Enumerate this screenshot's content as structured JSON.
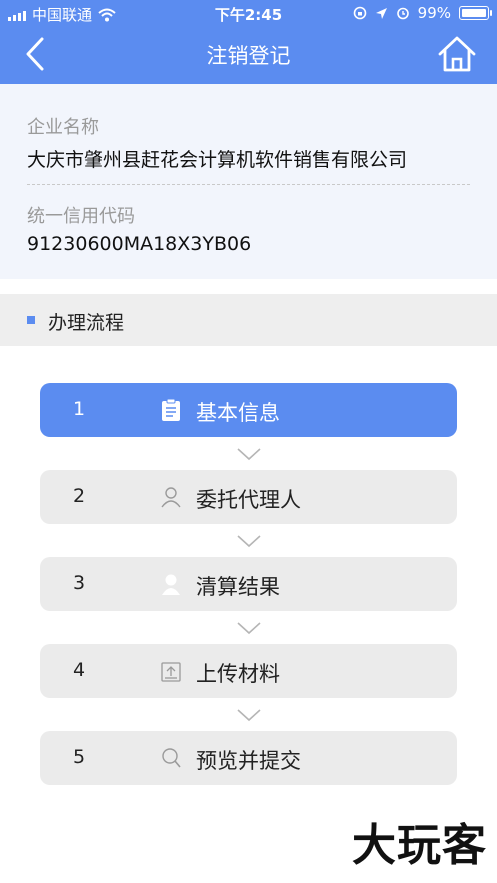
{
  "status_bar": {
    "carrier": "中国联通",
    "time": "下午2:45",
    "battery": "99%"
  },
  "nav": {
    "title": "注销登记",
    "back_icon": "chevron-left-icon",
    "home_icon": "home-icon"
  },
  "company": {
    "name_label": "企业名称",
    "name_value": "大庆市肇州县赶花会计算机软件销售有限公司",
    "code_label": "统一信用代码",
    "code_value": "91230600MA18X3YB06"
  },
  "section": {
    "title": "办理流程"
  },
  "steps": [
    {
      "num": "1",
      "label": "基本信息",
      "icon": "clipboard-icon",
      "active": true
    },
    {
      "num": "2",
      "label": "委托代理人",
      "icon": "person-outline-icon",
      "active": false
    },
    {
      "num": "3",
      "label": "清算结果",
      "icon": "person-icon",
      "active": false
    },
    {
      "num": "4",
      "label": "上传材料",
      "icon": "upload-icon",
      "active": false
    },
    {
      "num": "5",
      "label": "预览并提交",
      "icon": "search-icon",
      "active": false
    }
  ],
  "watermark": "大玩客",
  "colors": {
    "accent": "#5b8cf0",
    "info_background": "#f2f5fc",
    "step_background": "#ebebeb"
  }
}
